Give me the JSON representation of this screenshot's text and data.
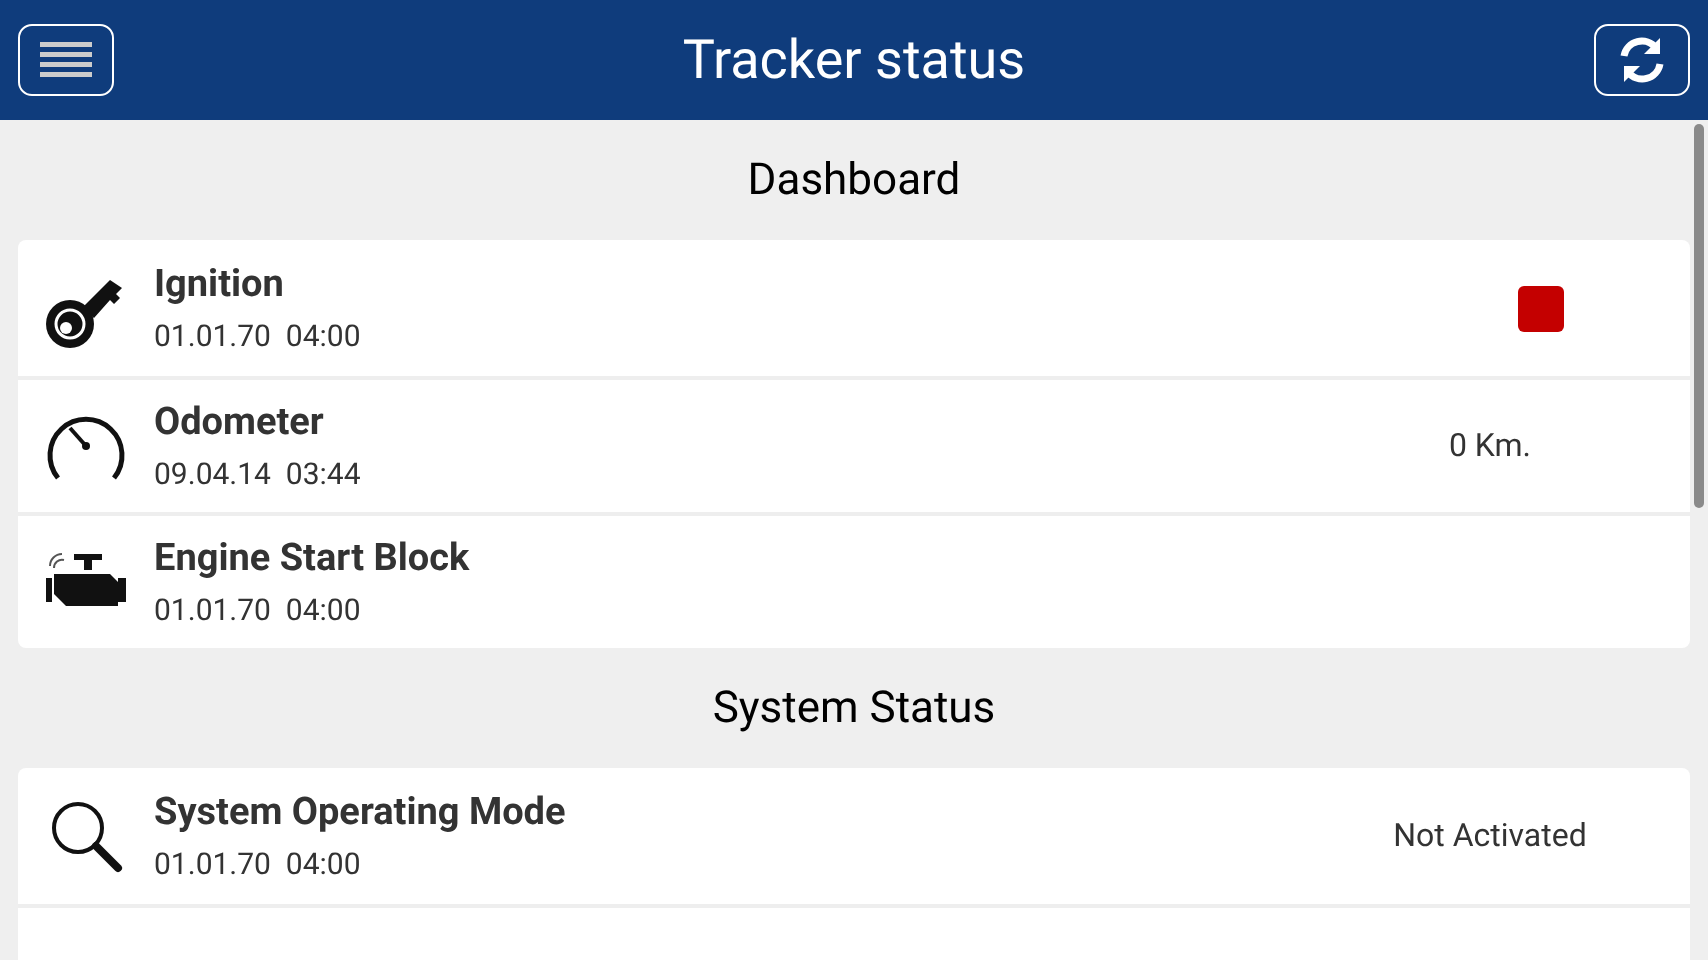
{
  "header": {
    "title": "Tracker status"
  },
  "sections": [
    {
      "title": "Dashboard",
      "items": [
        {
          "name": "Ignition",
          "timestamp": "01.01.70  04:00",
          "kind": "indicator",
          "color": "#c40000"
        },
        {
          "name": "Odometer",
          "timestamp": "09.04.14  03:44",
          "kind": "value",
          "value": "0 Km."
        },
        {
          "name": "Engine Start Block",
          "timestamp": "01.01.70  04:00",
          "kind": "none"
        }
      ]
    },
    {
      "title": "System Status",
      "items": [
        {
          "name": "System Operating Mode",
          "timestamp": "01.01.70  04:00",
          "kind": "value",
          "value": "Not Activated"
        },
        {
          "kind": "none"
        }
      ]
    }
  ]
}
